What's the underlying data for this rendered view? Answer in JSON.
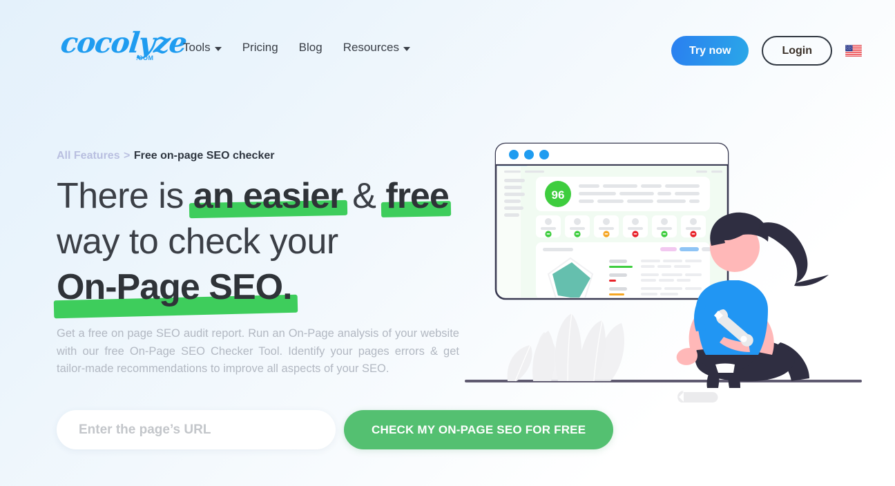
{
  "header": {
    "logo_text": "cocolyze",
    "logo_suffix": ".COM",
    "nav": [
      {
        "label": "Tools",
        "has_dropdown": true
      },
      {
        "label": "Pricing",
        "has_dropdown": false
      },
      {
        "label": "Blog",
        "has_dropdown": false
      },
      {
        "label": "Resources",
        "has_dropdown": true
      }
    ],
    "try_now_label": "Try now",
    "login_label": "Login",
    "language_flag": "us-flag-icon"
  },
  "hero": {
    "breadcrumb": {
      "parent": "All Features",
      "separator": ">",
      "current": "Free on-page SEO checker"
    },
    "headline": {
      "line1_prefix": "There is ",
      "line1_hl1": "an easier",
      "line1_mid": " & ",
      "line1_hl2": "free",
      "line2": "way to check your",
      "line3_hl": "On-Page SEO."
    },
    "description": "Get a free on page SEO audit report. Run an On-Page analysis of your website with our free On-Page SEO Checker Tool. Identify your pages errors & get tailor-made recommendations to improve all aspects of your SEO.",
    "form": {
      "input_placeholder": "Enter the page’s URL",
      "input_value": "",
      "submit_label": "CHECK MY ON-PAGE SEO FOR FREE"
    }
  },
  "illustration": {
    "mockup": {
      "score": "96",
      "score_color": "#3ecd3e",
      "window_dots": [
        "#1f9cf0",
        "#1f9cf0",
        "#1f9cf0"
      ],
      "metric_badges": [
        "#3ecd3e",
        "#3ecd3e",
        "#f5a623",
        "#e8232a",
        "#3ecd3e",
        "#e8232a"
      ],
      "tag_colors": [
        "#f2c8f0",
        "#8fc4f5",
        "#e4e6ea"
      ],
      "progress_colors": [
        "#3ecd3e",
        "#e8232a",
        "#f5a623"
      ],
      "radar_fill": "#65bfae"
    },
    "character": {
      "shirt_color": "#2196f3",
      "skin_color": "#ffb8b8",
      "hair_color": "#2f2e41",
      "pants_color": "#2f2e41",
      "tool": "wrench-icon"
    },
    "ground_color": "#5f5a70",
    "plant_color": "#f0f0f2"
  }
}
